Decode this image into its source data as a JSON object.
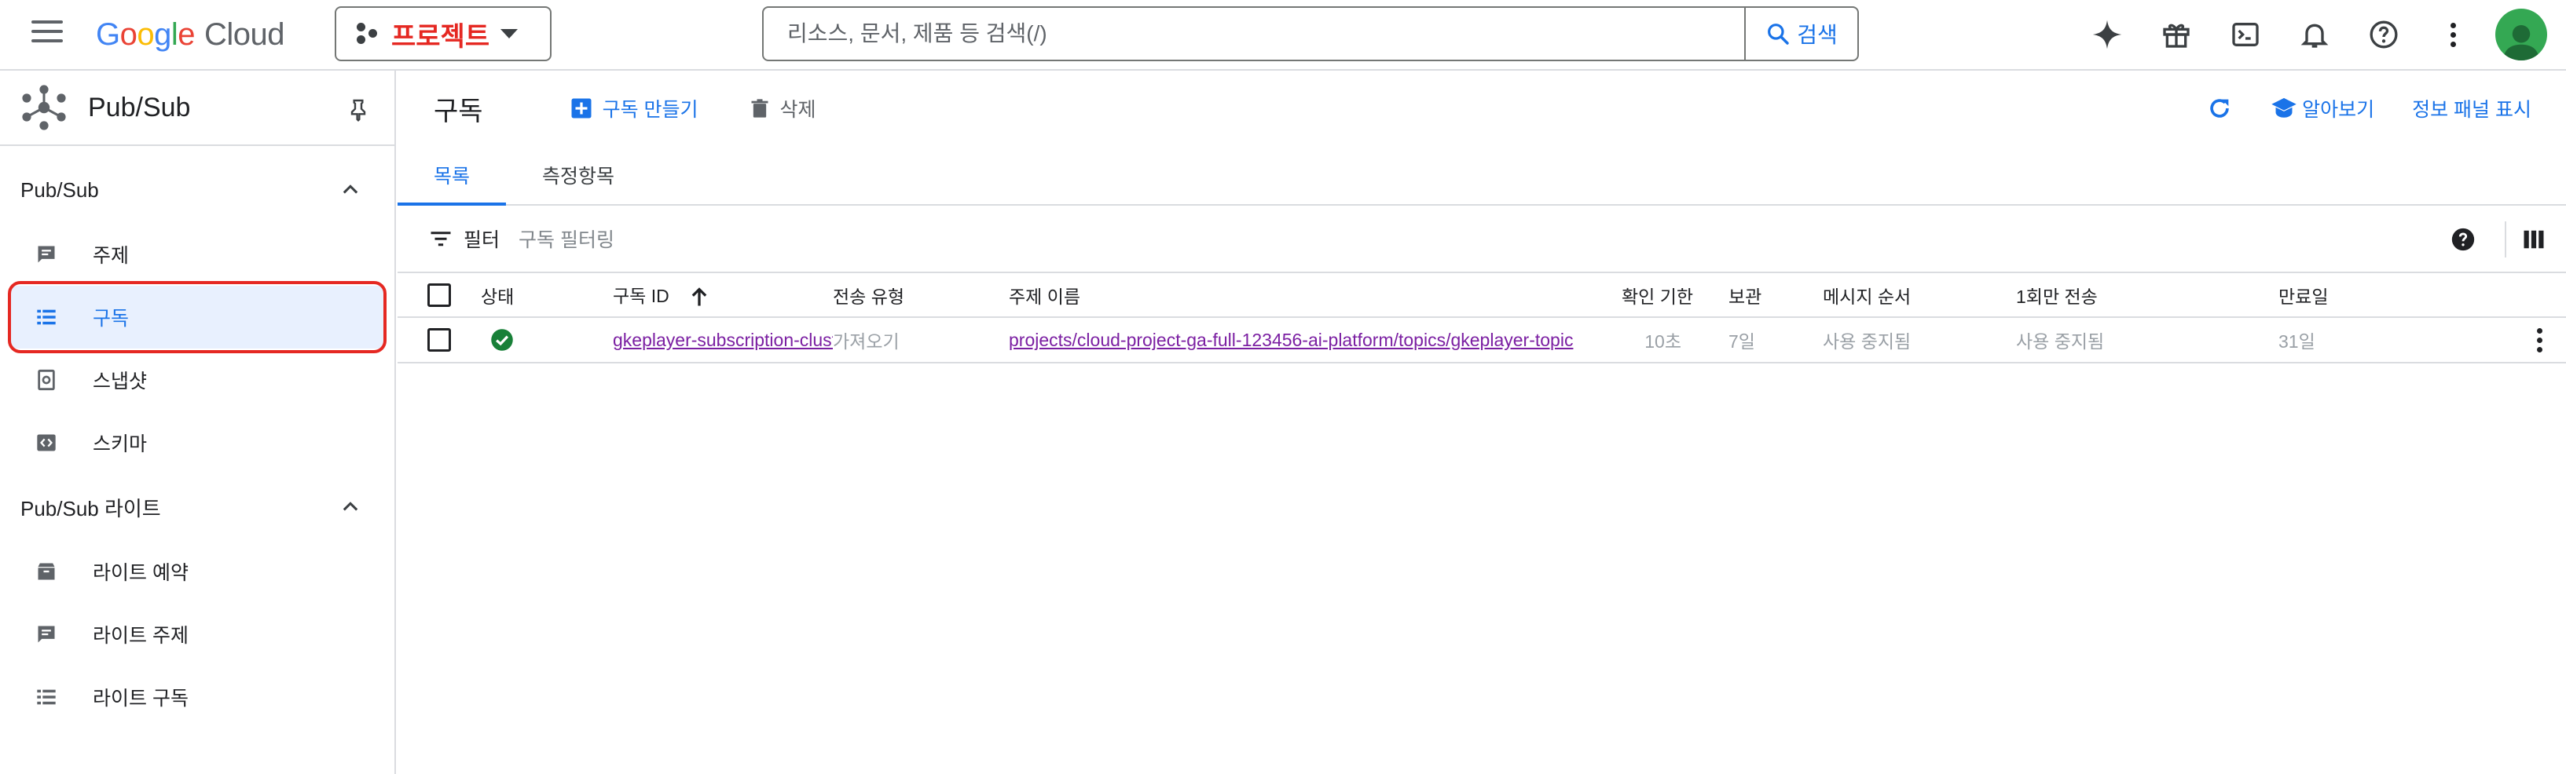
{
  "topbar": {
    "logo_google": [
      "G",
      "o",
      "o",
      "g",
      "l",
      "e"
    ],
    "logo_cloud": "Cloud",
    "project_label": "프로젝트",
    "search_placeholder": "리소스, 문서, 제품 등 검색(/)",
    "search_button": "검색",
    "icons": [
      "gemini-sparkle-icon",
      "gift-icon",
      "cloud-shell-icon",
      "notifications-icon",
      "help-icon",
      "more-vert-icon",
      "account-avatar"
    ]
  },
  "sidebar": {
    "product": "Pub/Sub",
    "sections": [
      {
        "title": "Pub/Sub",
        "items": [
          {
            "label": "주제",
            "icon": "topic-icon"
          },
          {
            "label": "구독",
            "icon": "subscription-list-icon",
            "active": true
          },
          {
            "label": "스냅샷",
            "icon": "snapshot-icon"
          },
          {
            "label": "스키마",
            "icon": "schema-icon"
          }
        ]
      },
      {
        "title": "Pub/Sub 라이트",
        "items": [
          {
            "label": "라이트 예약",
            "icon": "reservation-icon"
          },
          {
            "label": "라이트 주제",
            "icon": "topic-icon"
          },
          {
            "label": "라이트 구독",
            "icon": "subscription-list-icon"
          }
        ]
      }
    ]
  },
  "main": {
    "title": "구독",
    "create_label": "구독 만들기",
    "delete_label": "삭제",
    "learn_label": "알아보기",
    "info_panel_label": "정보 패널 표시",
    "tabs": [
      "목록",
      "측정항목"
    ],
    "filter_label": "필터",
    "filter_placeholder": "구독 필터링",
    "columns": [
      "상태",
      "구독 ID",
      "전송 유형",
      "주제 이름",
      "확인 기한",
      "보관",
      "메시지 순서",
      "1회만 전송",
      "만료일"
    ],
    "rows": [
      {
        "status": "ok",
        "subscription_id": "gkeplayer-subscription-cluster",
        "delivery_type": "가져오기",
        "topic_name": "projects/cloud-project-ga-full-123456-ai-platform/topics/gkeplayer-topic",
        "ack_deadline": "10초",
        "retention": "7일",
        "message_ordering": "사용 중지됨",
        "exactly_once": "사용 중지됨",
        "expiration": "31일"
      }
    ]
  },
  "colors": {
    "accent": "#1a73e8",
    "highlight": "#e52822",
    "success": "#188038"
  }
}
